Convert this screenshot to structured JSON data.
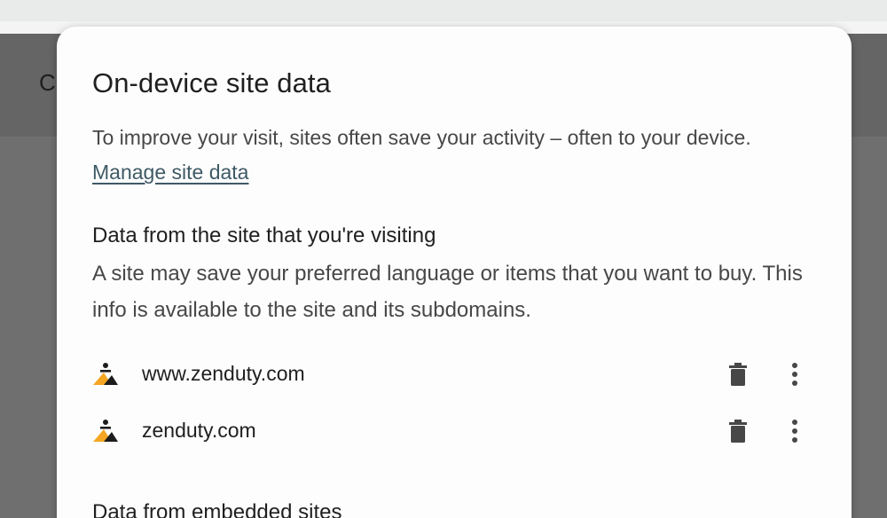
{
  "background": {
    "partial_text": "C"
  },
  "dialog": {
    "title": "On-device site data",
    "intro_text": "To improve your visit, sites often save your activity – often to your device. ",
    "manage_link": "Manage site data",
    "sections": [
      {
        "heading": "Data from the site that you're visiting",
        "description": "A site may save your preferred language or items that you want to buy. This info is available to the site and its subdomains.",
        "sites": [
          {
            "name": "www.zenduty.com",
            "icon": "zenduty-favicon"
          },
          {
            "name": "zenduty.com",
            "icon": "zenduty-favicon"
          }
        ]
      },
      {
        "heading": "Data from embedded sites"
      }
    ],
    "row_actions": {
      "delete_icon": "trash-icon",
      "more_icon": "more-vert-icon"
    }
  },
  "colors": {
    "link": "#3f5a66",
    "favicon_orange": "#f5a623",
    "favicon_dark": "#1c1c1c",
    "icon_gray": "#474747"
  }
}
